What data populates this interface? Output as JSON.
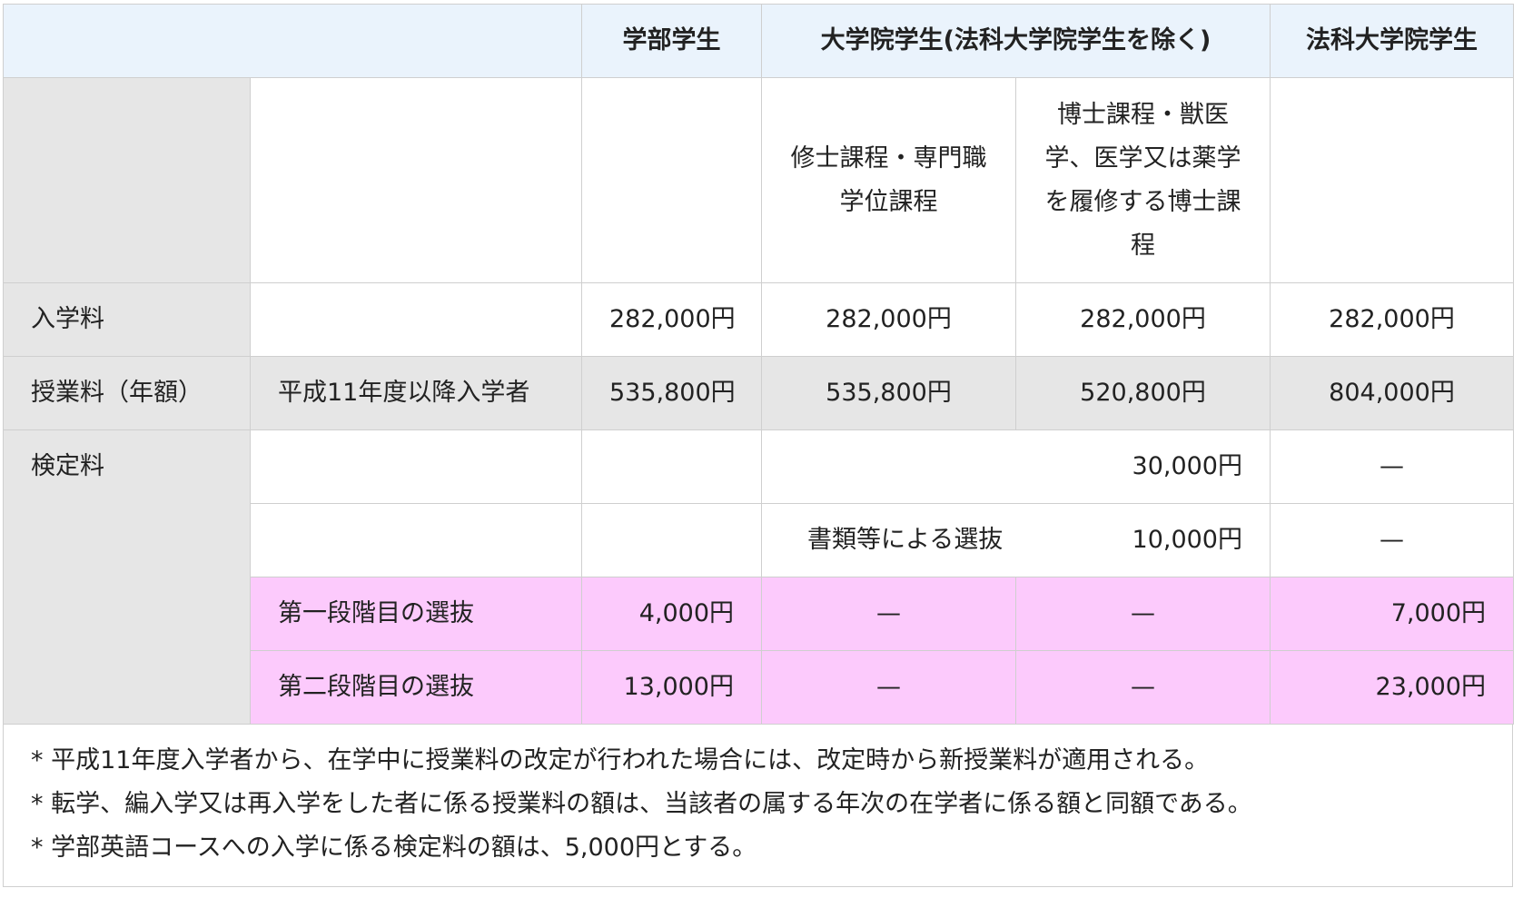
{
  "header": {
    "empty": "",
    "undergrad": "学部学生",
    "grad": "大学院学生(法科大学院学生を除く)",
    "law": "法科大学院学生"
  },
  "subheader": {
    "masters": "修士課程・専門職学位課程",
    "doctoral": "博士課程・獣医学、医学又は薬学を履修する博士課程"
  },
  "rows": {
    "admission": {
      "label": "入学料",
      "undergrad": "282,000円",
      "masters": "282,000円",
      "doctoral": "282,000円",
      "law": "282,000円"
    },
    "tuition": {
      "label": "授業料（年額）",
      "sub": "平成11年度以降入学者",
      "undergrad": "535,800円",
      "masters": "535,800円",
      "doctoral": "520,800円",
      "law": "804,000円"
    },
    "exam": {
      "label": "検定料",
      "row1": {
        "grad": "30,000円",
        "law": "—"
      },
      "row2": {
        "grad_sub": "書類等による選抜",
        "grad": "10,000円",
        "law": "—"
      },
      "row3": {
        "sub": "第一段階目の選抜",
        "undergrad": "4,000円",
        "masters": "—",
        "doctoral": "—",
        "law": "7,000円"
      },
      "row4": {
        "sub": "第二段階目の選抜",
        "undergrad": "13,000円",
        "masters": "—",
        "doctoral": "—",
        "law": "23,000円"
      }
    }
  },
  "notes": [
    "* 平成11年度入学者から、在学中に授業料の改定が行われた場合には、改定時から新授業料が適用される。",
    "* 転学、編入学又は再入学をした者に係る授業料の額は、当該者の属する年次の在学者に係る額と同額である。",
    "* 学部英語コースへの入学に係る検定料の額は、5,000円とする。"
  ],
  "colors": {
    "header_bg": "#eaf3fc",
    "gray_bg": "#e6e6e6",
    "pink_bg": "#fccafc",
    "border": "#cfcfcf"
  }
}
